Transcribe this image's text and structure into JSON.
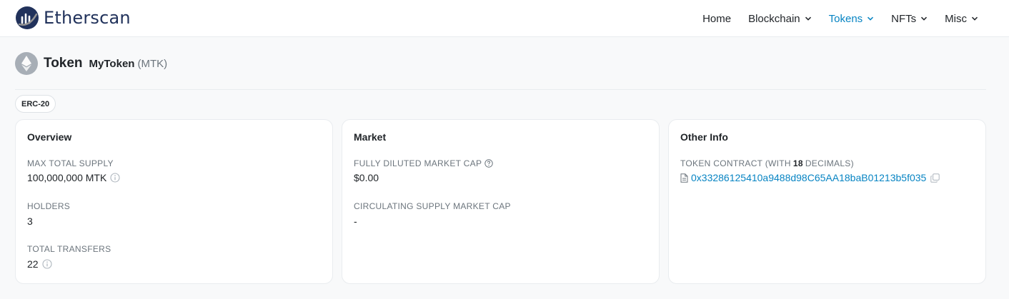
{
  "header": {
    "brand": "Etherscan",
    "nav": [
      {
        "label": "Home"
      },
      {
        "label": "Blockchain"
      },
      {
        "label": "Tokens"
      },
      {
        "label": "NFTs"
      },
      {
        "label": "Misc"
      }
    ],
    "active_nav": "Tokens",
    "accent_color": "#0784c3"
  },
  "page": {
    "title": "Token",
    "token_name": "MyToken",
    "token_symbol": "(MTK)",
    "standard_badge": "ERC-20"
  },
  "overview": {
    "title": "Overview",
    "max_supply_label": "MAX TOTAL SUPPLY",
    "max_supply_value": "100,000,000 MTK",
    "holders_label": "HOLDERS",
    "holders_value": "3",
    "transfers_label": "TOTAL TRANSFERS",
    "transfers_value": "22"
  },
  "market": {
    "title": "Market",
    "fdmc_label": "FULLY DILUTED MARKET CAP",
    "fdmc_value": "$0.00",
    "csmc_label": "CIRCULATING SUPPLY MARKET CAP",
    "csmc_value": "-"
  },
  "other_info": {
    "title": "Other Info",
    "contract_label_prefix": "TOKEN CONTRACT (WITH",
    "decimals": "18",
    "contract_label_suffix": "DECIMALS)",
    "contract_address": "0x33286125410a9488d98C65AA18baB01213b5f035"
  }
}
